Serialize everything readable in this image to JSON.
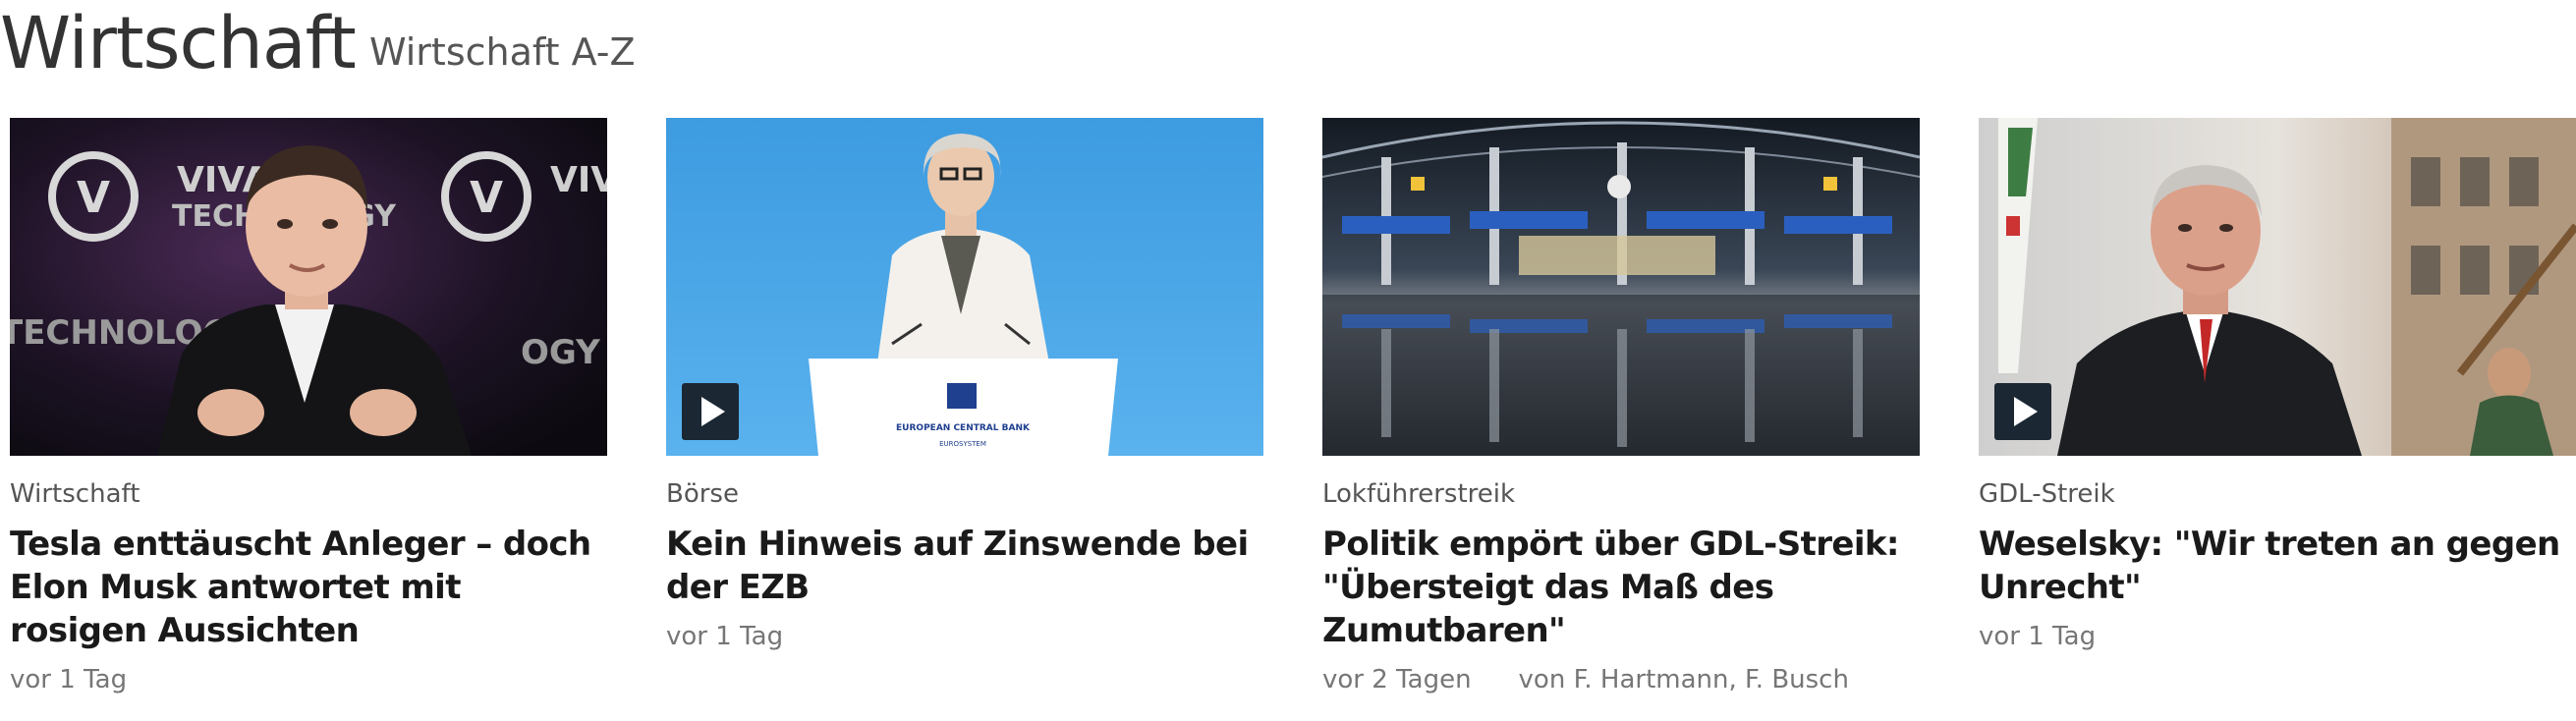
{
  "section": {
    "title": "Wirtschaft",
    "link_label": "Wirtschaft A-Z"
  },
  "teasers": [
    {
      "topline": "Wirtschaft",
      "headline": "Tesla enttäuscht Anleger – doch Elon Musk antwortet mit rosigen Aussichten",
      "date": "vor 1 Tag",
      "author": "",
      "has_video": false,
      "image_text": [
        "VIVA",
        "TECHNOLOGY"
      ]
    },
    {
      "topline": "Börse",
      "headline": "Kein Hinweis auf Zinswende bei der EZB",
      "date": "vor 1 Tag",
      "author": "",
      "has_video": true,
      "image_text": [
        "EUROPEAN CENTRAL BANK",
        "EUROSYSTEM"
      ]
    },
    {
      "topline": "Lokführerstreik",
      "headline": "Politik empört über GDL-Streik: \"Übersteigt das Maß des Zumutbaren\"",
      "date": "vor 2 Tagen",
      "author": "von F. Hartmann, F. Busch",
      "has_video": false,
      "image_text": []
    },
    {
      "topline": "GDL-Streik",
      "headline": "Weselsky: \"Wir treten an gegen Unrecht\"",
      "date": "vor 1 Tag",
      "author": "",
      "has_video": true,
      "image_text": []
    }
  ],
  "colors": {
    "title": "#333333",
    "headline": "#1a1a1a",
    "meta": "#767676",
    "play_button": "#1b2733"
  },
  "icons": {
    "play": "play-icon"
  }
}
